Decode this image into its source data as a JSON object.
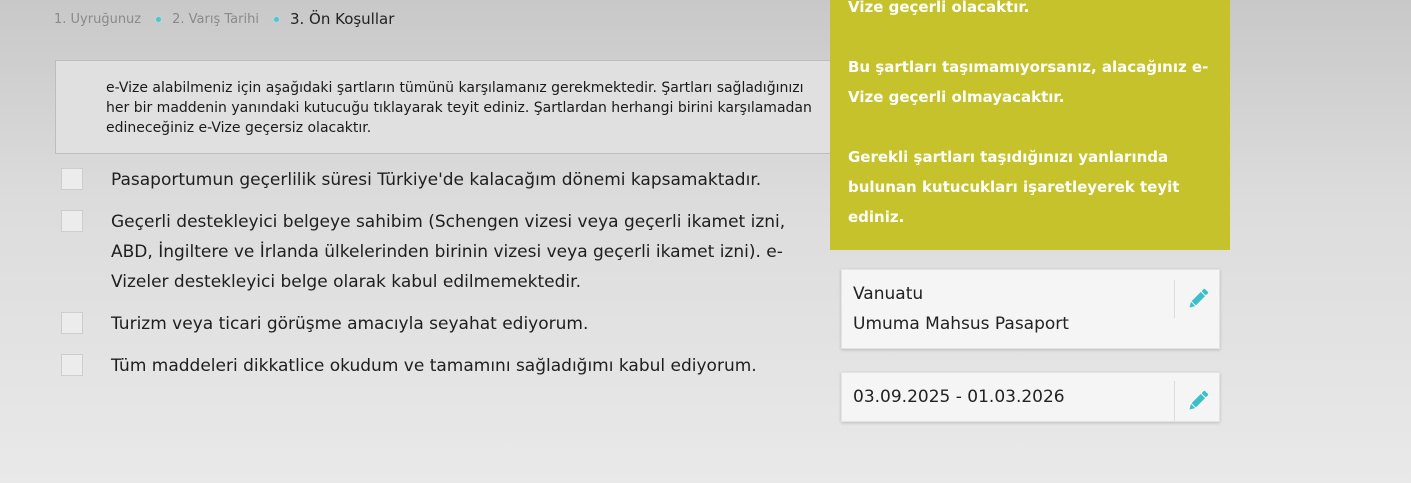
{
  "steps": [
    {
      "label": "1. Uyruğunuz"
    },
    {
      "label": "2. Varış Tarihi"
    },
    {
      "label": "3. Ön Koşullar"
    }
  ],
  "notice": {
    "text": "e-Vize alabilmeniz için aşağıdaki şartların tümünü karşılamanız gerekmektedir. Şartları sağladığınızı her bir maddenin yanındaki kutucuğu tıklayarak teyit ediniz. Şartlardan herhangi birini karşılamadan edineceğiniz e-Vize geçersiz olacaktır."
  },
  "conditions": [
    {
      "text": "Pasaportumun geçerlilik süresi Türkiye'de kalacağım dönemi kapsamaktadır.",
      "checked": false
    },
    {
      "text": "Geçerli destekleyici belgeye sahibim (Schengen vizesi veya geçerli ikamet izni, ABD, İngiltere ve İrlanda ülkelerinden birinin vizesi veya geçerli ikamet izni). e-Vizeler destekleyici belge olarak kabul edilmemektedir.",
      "checked": false
    },
    {
      "text": "Turizm veya ticari görüşme amacıyla seyahat ediyorum.",
      "checked": false
    },
    {
      "text": "Tüm maddeleri dikkatlice okudum ve tamamını sağladığımı kabul ediyorum.",
      "checked": false
    }
  ],
  "info_panel": {
    "paragraphs": [
      "Vize geçerli olacaktır.",
      "Bu şartları taşımamıyorsanız, alacağınız e-Vize geçerli olmayacaktır.",
      "Gerekli şartları taşıdığınızı yanlarında bulunan kutucukları işaretleyerek teyit ediniz."
    ],
    "color": "#c6c22b"
  },
  "summary": {
    "country": "Vanuatu",
    "document_type": "Umuma Mahsus Pasaport",
    "date_range": "03.09.2025 - 01.03.2026"
  },
  "colors": {
    "accent_teal": "#3bbfc8",
    "step_dot": "#5bc0c8"
  },
  "icons": {
    "edit": "pencil-icon"
  }
}
